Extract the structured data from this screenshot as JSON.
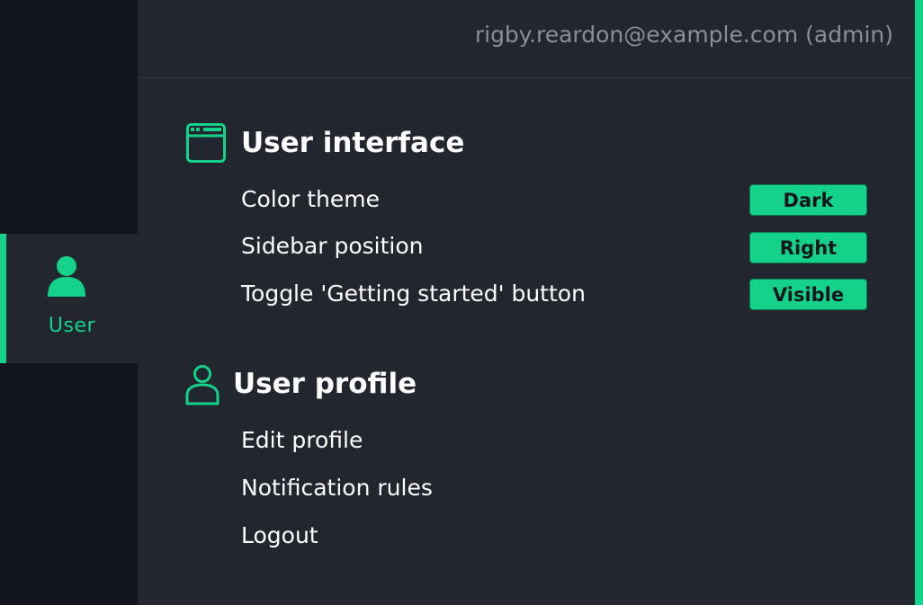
{
  "colors": {
    "accent": "#15d28a",
    "sidebar_bg": "#11161c",
    "main_bg": "#22272f",
    "text": "#ffffff",
    "muted_text": "#8a8f97"
  },
  "sidebar": {
    "active_item": {
      "icon": "user-icon",
      "label": "User"
    }
  },
  "header": {
    "user": "rigby.reardon@example.com (admin)"
  },
  "user_interface": {
    "icon": "window-icon",
    "title": "User interface",
    "items": [
      {
        "label": "Color theme",
        "value": "Dark"
      },
      {
        "label": "Sidebar position",
        "value": "Right"
      },
      {
        "label": "Toggle 'Getting started' button",
        "value": "Visible"
      }
    ]
  },
  "user_profile": {
    "icon": "user-outline-icon",
    "title": "User profile",
    "items": [
      {
        "label": "Edit profile"
      },
      {
        "label": "Notification rules"
      },
      {
        "label": "Logout"
      }
    ]
  }
}
